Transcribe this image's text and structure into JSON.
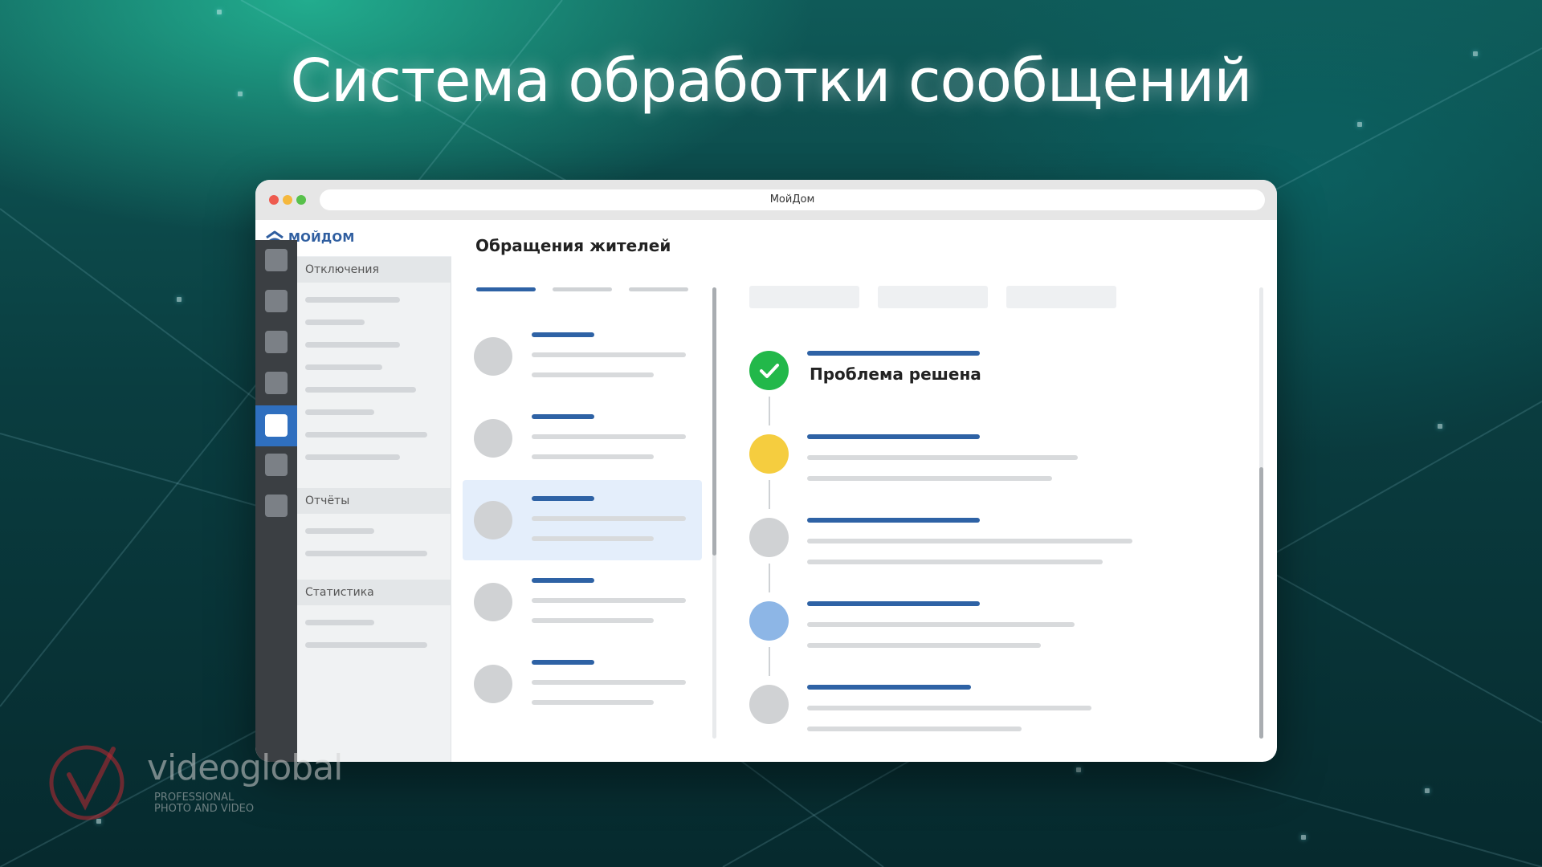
{
  "headline": "Система обработки сообщений",
  "browser": {
    "url_title": "МойДом"
  },
  "app": {
    "logo_text": "МОЙДОМ",
    "sidebar_sections": [
      {
        "label": "Отключения"
      },
      {
        "label": "Отчёты"
      },
      {
        "label": "Статистика"
      }
    ],
    "page_title": "Обращения жителей",
    "timeline": {
      "resolved_label": "Проблема решена",
      "steps": [
        {
          "status": "resolved",
          "color": "#22b84a"
        },
        {
          "status": "pending",
          "color": "#f5cd3f"
        },
        {
          "status": "inactive",
          "color": "#d0d2d4"
        },
        {
          "status": "in-progress",
          "color": "#8db6e6"
        },
        {
          "status": "inactive",
          "color": "#d0d2d4"
        }
      ]
    }
  },
  "watermark": {
    "brand": "videoglobal",
    "tagline_1": "PROFESSIONAL",
    "tagline_2": "PHOTO AND VIDEO"
  },
  "colors": {
    "accent_blue": "#2e62a5",
    "sidebar_dark": "#3b3f43",
    "active_rail": "#2f6fbf"
  }
}
